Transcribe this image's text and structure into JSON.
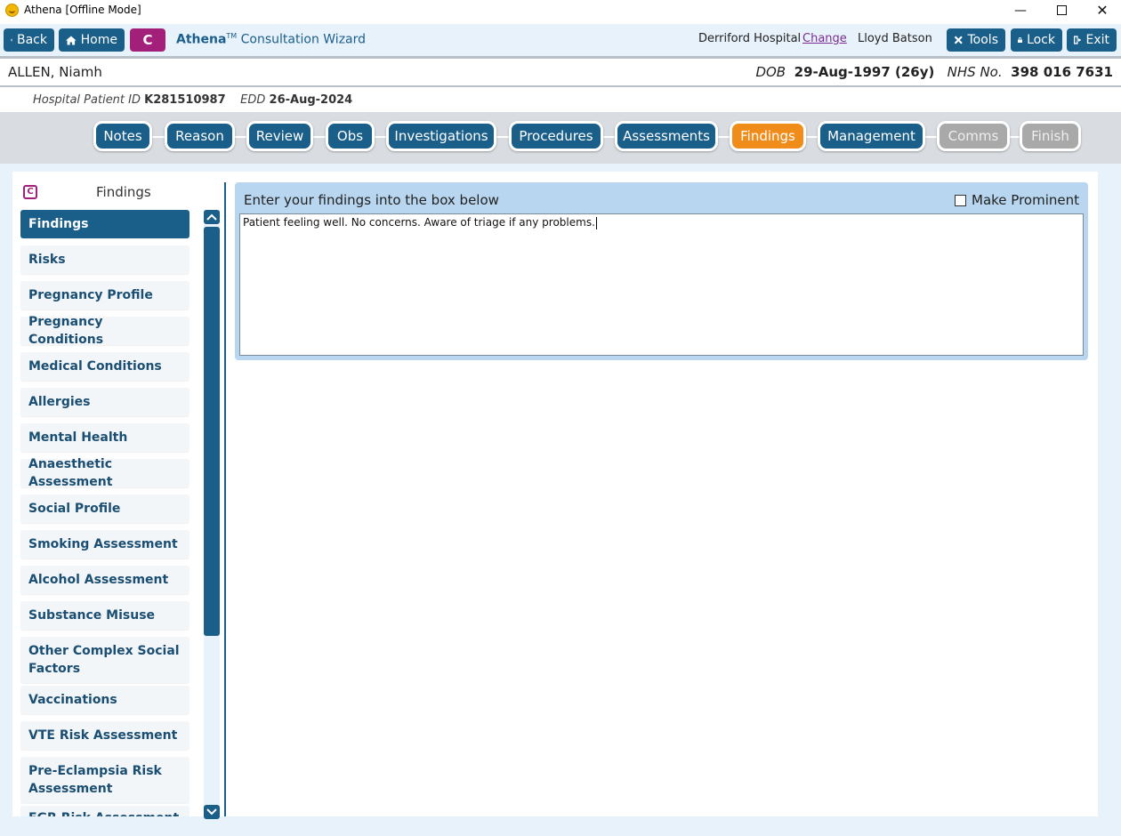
{
  "window": {
    "title": "Athena [Offline Mode]"
  },
  "toolbar": {
    "back_label": "Back",
    "home_label": "Home",
    "c_label": "C",
    "wizard_brand": "Athena",
    "wizard_tm": "TM",
    "wizard_title": "Consultation Wizard",
    "hospital": "Derriford Hospital",
    "change_label": "Change",
    "user": "Lloyd Batson",
    "tools_label": "Tools",
    "lock_label": "Lock",
    "exit_label": "Exit"
  },
  "patient": {
    "name": "ALLEN, Niamh",
    "dob_label": "DOB",
    "dob": "29-Aug-1997 (26y)",
    "nhs_label": "NHS No.",
    "nhs": "398 016 7631",
    "hospital_id_label": "Hospital Patient ID",
    "hospital_id": "K281510987",
    "edd_label": "EDD",
    "edd": "26-Aug-2024"
  },
  "steps": [
    {
      "label": "Notes",
      "state": "normal"
    },
    {
      "label": "Reason",
      "state": "normal"
    },
    {
      "label": "Review",
      "state": "normal"
    },
    {
      "label": "Obs",
      "state": "normal"
    },
    {
      "label": "Investigations",
      "state": "normal"
    },
    {
      "label": "Procedures",
      "state": "normal"
    },
    {
      "label": "Assessments",
      "state": "normal"
    },
    {
      "label": "Findings",
      "state": "active"
    },
    {
      "label": "Management",
      "state": "normal"
    },
    {
      "label": "Comms",
      "state": "disabled"
    },
    {
      "label": "Finish",
      "state": "disabled"
    }
  ],
  "sidebar": {
    "logo": "C",
    "title": "Findings",
    "items": [
      {
        "label": "Findings"
      },
      {
        "label": "Risks"
      },
      {
        "label": "Pregnancy Profile"
      },
      {
        "label": "Pregnancy Conditions"
      },
      {
        "label": "Medical Conditions"
      },
      {
        "label": "Allergies"
      },
      {
        "label": "Mental Health"
      },
      {
        "label": "Anaesthetic Assessment"
      },
      {
        "label": "Social Profile"
      },
      {
        "label": "Smoking Assessment"
      },
      {
        "label": "Alcohol Assessment"
      },
      {
        "label": "Substance Misuse"
      },
      {
        "label": "Other Complex Social Factors"
      },
      {
        "label": "Vaccinations"
      },
      {
        "label": "VTE Risk Assessment"
      },
      {
        "label": "Pre-Eclampsia Risk Assessment"
      },
      {
        "label": "FGR Risk Assessment"
      }
    ]
  },
  "findings": {
    "label": "Enter your findings into the box below",
    "prominent_label": "Make Prominent",
    "prominent_checked": false,
    "text": "Patient feeling well. No concerns. Aware of triage if any problems."
  },
  "colors": {
    "primary": "#1a5e8a",
    "active_step": "#f08c1a",
    "disabled_step": "#a9a9a9",
    "brand_c": "#a3207a"
  }
}
